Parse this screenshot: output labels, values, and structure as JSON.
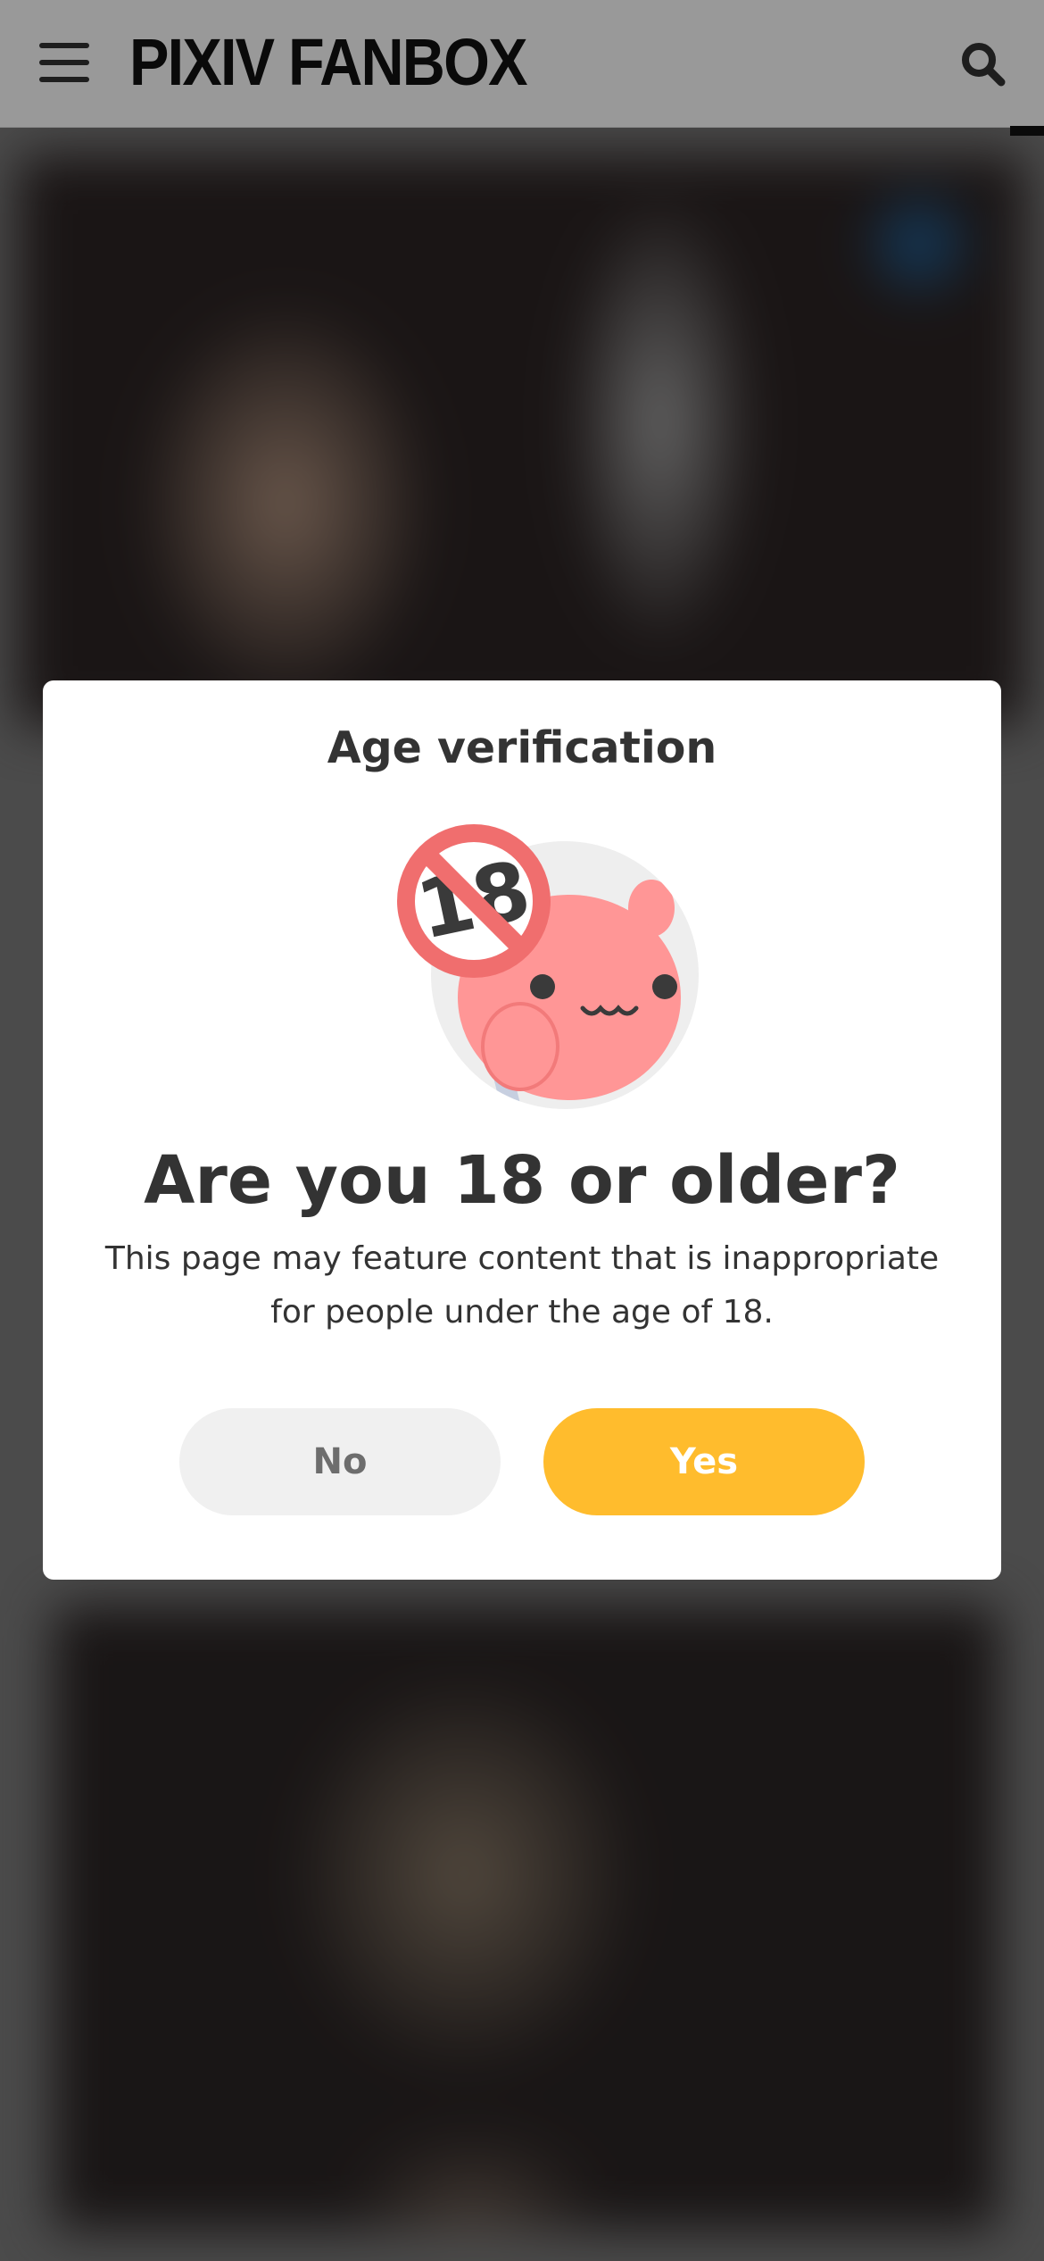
{
  "header": {
    "logo": "PIXIV FANBOX",
    "menu_icon": "hamburger-menu-icon",
    "search_icon": "search-icon"
  },
  "modal": {
    "title": "Age verification",
    "illustration_icon": "age-restriction-mascot-icon",
    "illustration_sign_text": "18",
    "headline": "Are you 18 or older?",
    "description": "This page may feature content that is inappropriate for people under the age of 18.",
    "no_label": "No",
    "yes_label": "Yes"
  },
  "colors": {
    "accent_yes": "#ffbc2d",
    "button_no_bg": "#f0f0f0",
    "text_primary": "#333333",
    "mascot_pink": "#ff9696",
    "sign_red": "#f06e6e"
  }
}
